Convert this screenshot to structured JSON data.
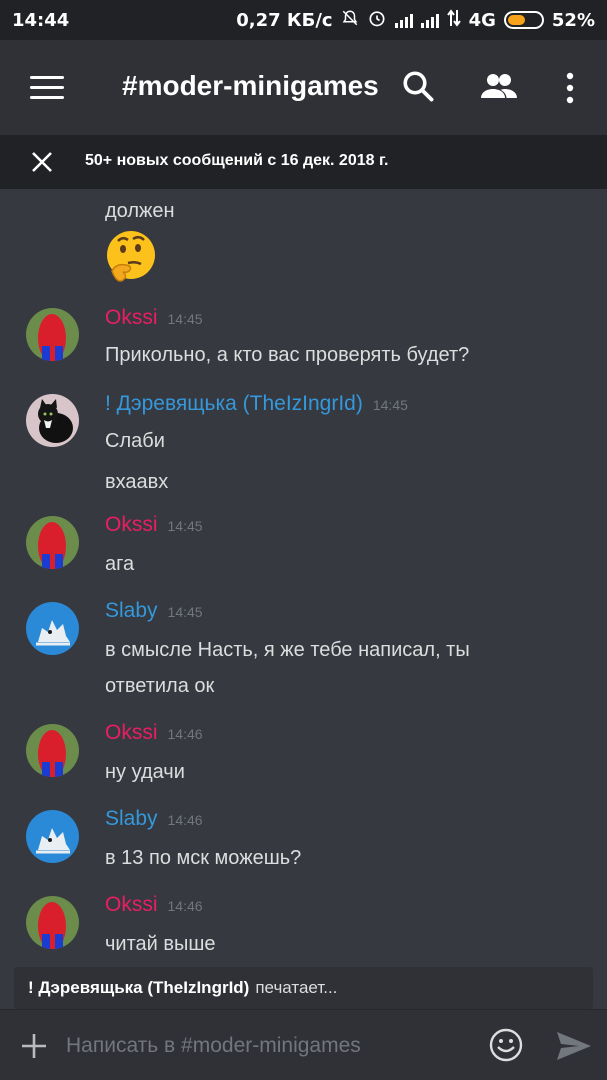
{
  "status_bar": {
    "time": "14:44",
    "network_speed": "0,27 КБ/с",
    "network_type": "4G",
    "battery": "52%",
    "battery_level": 0.52
  },
  "header": {
    "channel_title": "#moder-minigames",
    "icons": [
      "menu-icon",
      "search-icon",
      "members-icon",
      "more-vertical-icon"
    ]
  },
  "banner": {
    "text": "50+ новых сообщений с 16 дек. 2018 г."
  },
  "messages": [
    {
      "author": "",
      "timestamp": "",
      "lines": [
        "должен"
      ],
      "emoji": "thinking-face-emoji"
    },
    {
      "author": "Okssi",
      "author_color": "#e91e63",
      "timestamp": "14:45",
      "lines": [
        "Прикольно, а кто вас проверять будет?"
      ]
    },
    {
      "author": "! Дэревящька (TheIzIngrId)",
      "author_color": "#3498db",
      "timestamp": "14:45",
      "lines": [
        "Слаби",
        "вхаавх"
      ]
    },
    {
      "author": "Okssi",
      "author_color": "#e91e63",
      "timestamp": "14:45",
      "lines": [
        "ага"
      ]
    },
    {
      "author": "Slaby",
      "author_color": "#3498db",
      "timestamp": "14:45",
      "lines": [
        "в смысле Насть, я же тебе написал, ты",
        "ответила ок"
      ]
    },
    {
      "author": "Okssi",
      "author_color": "#e91e63",
      "timestamp": "14:46",
      "lines": [
        "ну удачи"
      ]
    },
    {
      "author": "Slaby",
      "author_color": "#3498db",
      "timestamp": "14:46",
      "lines": [
        "в 13 по мск можешь?"
      ]
    },
    {
      "author": "Okssi",
      "author_color": "#e91e63",
      "timestamp": "14:46",
      "lines": [
        "читай выше"
      ]
    }
  ],
  "typing": {
    "user": "! Дэревящька (TheIzIngrId)",
    "suffix": "печатает..."
  },
  "composer": {
    "placeholder": "Написать в #moder-minigames"
  },
  "colors": {
    "background": "#36393f",
    "header": "#2f3136",
    "banner": "#202225",
    "okssi": "#e91e63",
    "blue_user": "#3498db",
    "timestamp": "#72767d"
  }
}
